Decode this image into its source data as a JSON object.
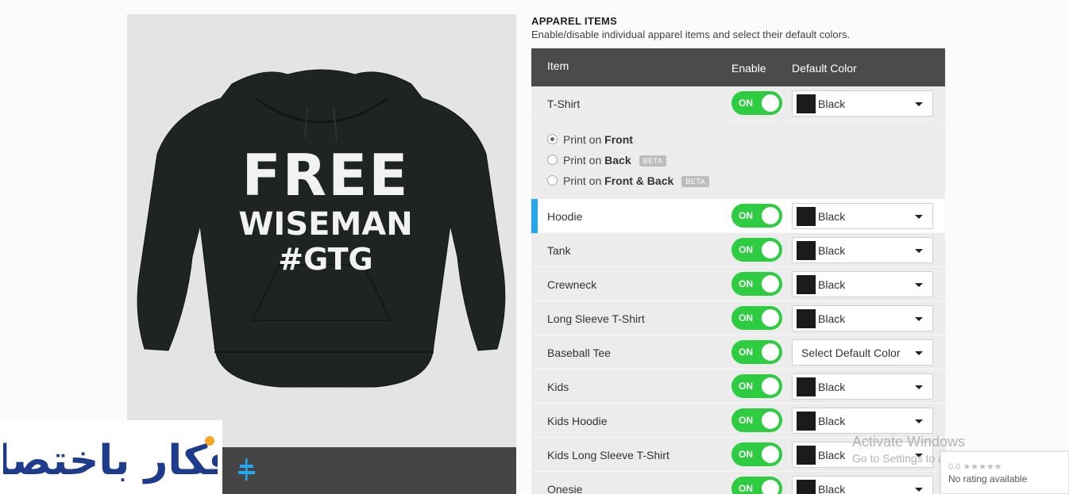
{
  "section": {
    "title": "APPAREL ITEMS",
    "subtitle": "Enable/disable individual apparel items and select their default colors."
  },
  "table": {
    "headers": {
      "item": "Item",
      "enable": "Enable",
      "color": "Default Color"
    },
    "toggle_label": "ON",
    "rows": [
      {
        "label": "T-Shirt",
        "color": "Black"
      },
      {
        "label": "Hoodie",
        "color": "Black"
      },
      {
        "label": "Tank",
        "color": "Black"
      },
      {
        "label": "Crewneck",
        "color": "Black"
      },
      {
        "label": "Long Sleeve T-Shirt",
        "color": "Black"
      },
      {
        "label": "Baseball Tee",
        "color": "Select Default Color"
      },
      {
        "label": "Kids",
        "color": "Black"
      },
      {
        "label": "Kids Hoodie",
        "color": "Black"
      },
      {
        "label": "Kids Long Sleeve T-Shirt",
        "color": "Black"
      },
      {
        "label": "Onesie",
        "color": "Black"
      }
    ],
    "active_row": "Hoodie",
    "swatch_color": "#1b1b1b"
  },
  "print_options": {
    "prefix": "Print on",
    "options": [
      {
        "target": "Front",
        "beta": "",
        "checked": true
      },
      {
        "target": "Back",
        "beta": "BETA",
        "checked": false
      },
      {
        "target": "Front & Back",
        "beta": "BETA",
        "checked": false
      }
    ]
  },
  "preview": {
    "design_lines": [
      "FREE",
      "WISEMAN",
      "#GTG"
    ],
    "product_color": "#1e2422"
  },
  "watermark": {
    "logo_text": "أفكار باختصار",
    "activate_title": "Activate Windows",
    "activate_sub": "Go to Settings to activate Windows."
  },
  "rating": {
    "score": "0.0 ★★★★★",
    "text": "No rating available"
  },
  "colors": {
    "toggle_on": "#2ecc40",
    "active_indicator": "#22a7f0",
    "header_bg": "#4b4b4b"
  }
}
